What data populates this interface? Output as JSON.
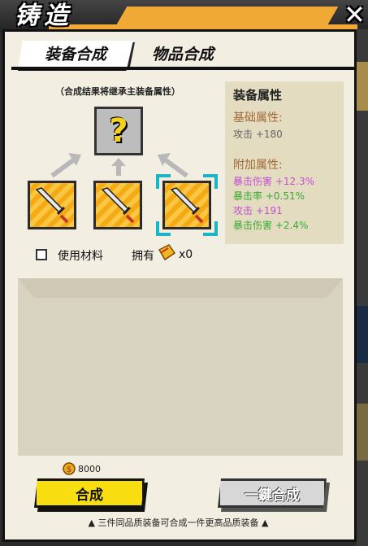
{
  "window": {
    "title": "铸造",
    "close_symbol": "✕"
  },
  "tabs": [
    {
      "label": "装备合成",
      "active": true
    },
    {
      "label": "物品合成",
      "active": false
    }
  ],
  "forge": {
    "hint": "（合成结果将继承主装备属性）",
    "result_placeholder": "?",
    "materials": [
      {
        "icon": "sword-icon",
        "selected": false
      },
      {
        "icon": "sword-icon",
        "selected": false
      },
      {
        "icon": "sword-icon",
        "selected": true
      }
    ],
    "use_material_label": "使用材料",
    "use_material_checked": false,
    "own_label": "拥有",
    "own_count": "x0"
  },
  "attributes": {
    "title": "装备属性",
    "base_title": "基础属性:",
    "base": [
      {
        "text": "攻击 +180",
        "color": "#666666"
      }
    ],
    "extra_title": "附加属性:",
    "extra": [
      {
        "text": "暴击伤害 +12.3%",
        "color": "#c04fd0"
      },
      {
        "text": "暴击率 +0.51%",
        "color": "#3aa832"
      },
      {
        "text": "攻击 +191",
        "color": "#c04fd0"
      },
      {
        "text": "暴击伤害 +2.4%",
        "color": "#3aa832"
      }
    ]
  },
  "cost": {
    "value": "8000"
  },
  "buttons": {
    "forge": "合成",
    "one_key": "一鍵合成"
  },
  "footer_tip": "三件同品质装备可合成一件更高品质装备"
}
